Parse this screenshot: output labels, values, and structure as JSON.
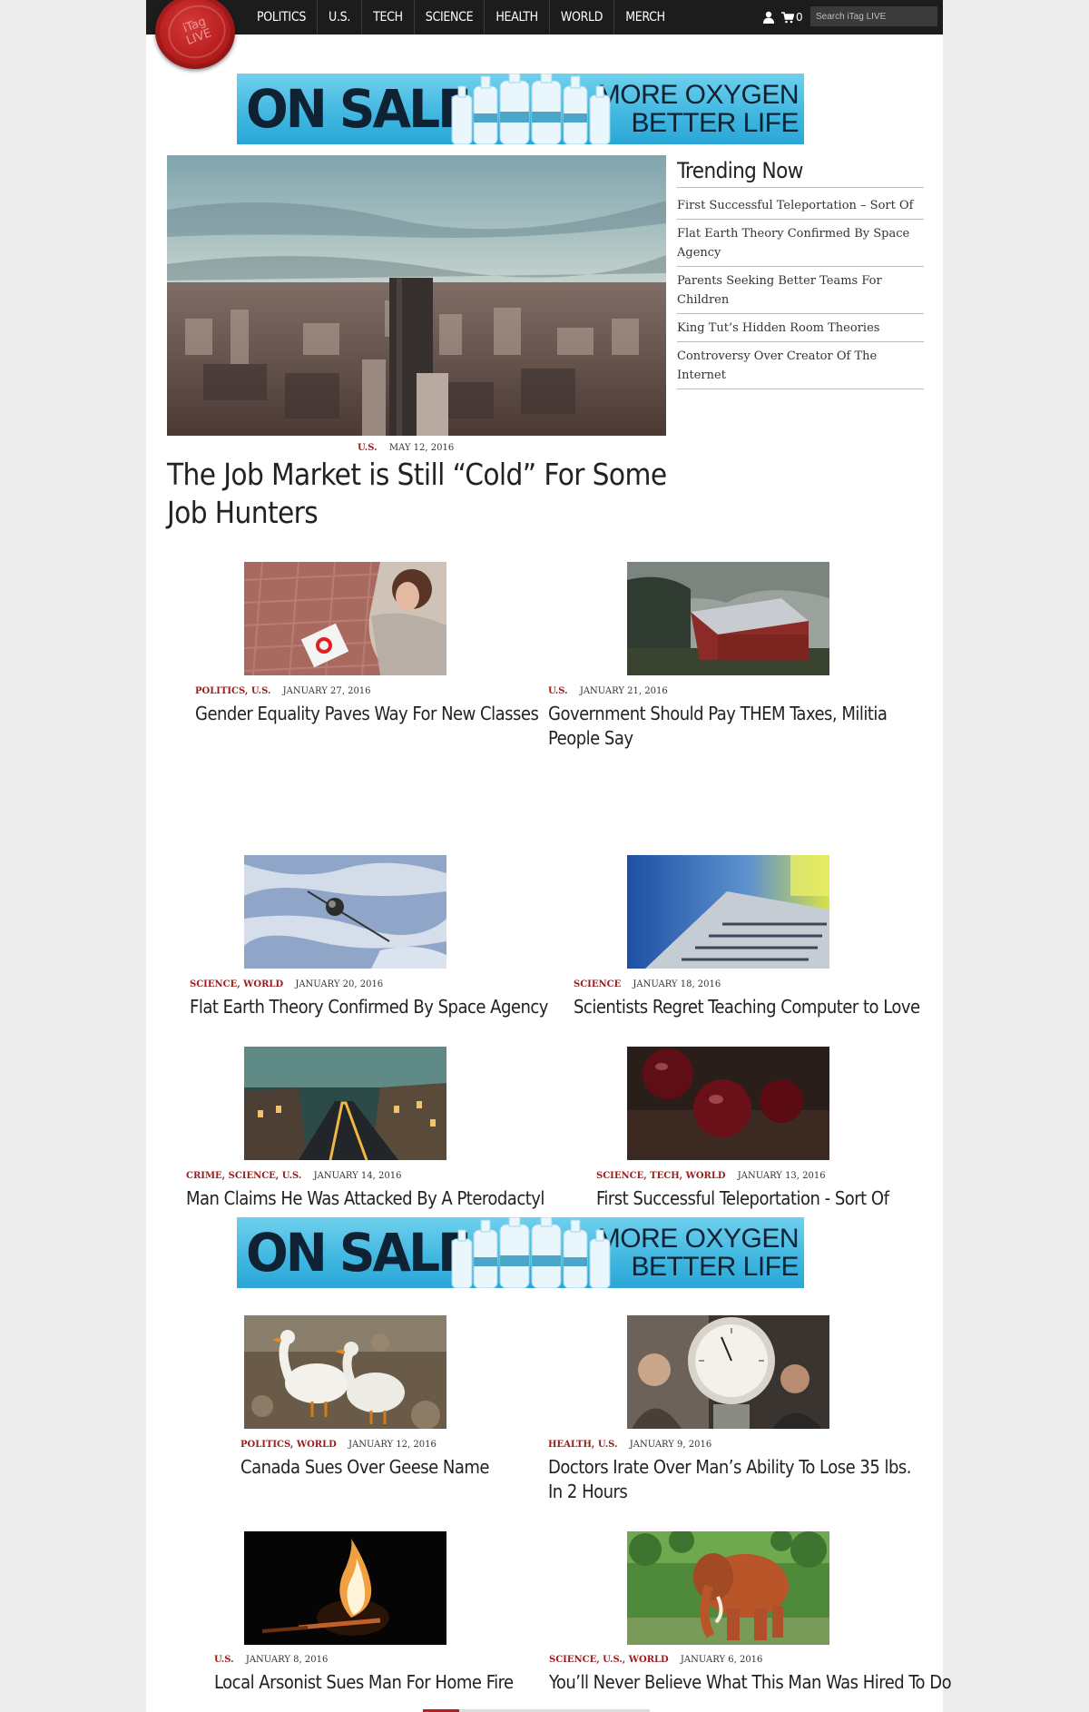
{
  "logo": {
    "line1": "iTag",
    "line2": "LIVE"
  },
  "nav": {
    "items": [
      "POLITICS",
      "U.S.",
      "TECH",
      "SCIENCE",
      "HEALTH",
      "WORLD",
      "MERCH"
    ]
  },
  "header": {
    "cart_count": "0",
    "search_placeholder": "Search iTag LIVE"
  },
  "banner": {
    "left": "ON SALE",
    "right_line1": "MORE OXYGEN",
    "right_line2": "BETTER LIFE"
  },
  "hero": {
    "categories": "U.S.",
    "date": "MAY 12, 2016",
    "title": "The Job Market is Still “Cold” For Some Job Hunters"
  },
  "trending": {
    "heading": "Trending Now",
    "items": [
      "First Successful Teleportation – Sort Of",
      "Flat Earth Theory Confirmed By Space Agency",
      "Parents Seeking Better Teams For Children",
      "King Tut’s Hidden Room Theories",
      "Controversy Over Creator Of The Internet"
    ]
  },
  "articles": [
    {
      "categories": "POLITICS, U.S.",
      "date": "JANUARY 27, 2016",
      "title": "Gender Equality Paves Way For New Classes"
    },
    {
      "categories": "U.S.",
      "date": "JANUARY 21, 2016",
      "title": "Government Should Pay THEM Taxes, Militia People Say"
    },
    {
      "categories": "SCIENCE, WORLD",
      "date": "JANUARY 20, 2016",
      "title": "Flat Earth Theory Confirmed By Space Agency"
    },
    {
      "categories": "SCIENCE",
      "date": "JANUARY 18, 2016",
      "title": "Scientists Regret Teaching Computer to Love"
    },
    {
      "categories": "CRIME, SCIENCE, U.S.",
      "date": "JANUARY 14, 2016",
      "title": "Man Claims He Was Attacked By A Pterodactyl"
    },
    {
      "categories": "SCIENCE, TECH, WORLD",
      "date": "JANUARY 13, 2016",
      "title": "First Successful Teleportation - Sort Of"
    },
    {
      "categories": "POLITICS, WORLD",
      "date": "JANUARY 12, 2016",
      "title": "Canada Sues Over Geese Name"
    },
    {
      "categories": "HEALTH, U.S.",
      "date": "JANUARY 9, 2016",
      "title": "Doctors Irate Over Man’s Ability To Lose 35 lbs. In 2 Hours"
    },
    {
      "categories": "U.S.",
      "date": "JANUARY 8, 2016",
      "title": "Local Arsonist Sues Man For Home Fire"
    },
    {
      "categories": "SCIENCE, U.S., WORLD",
      "date": "JANUARY 6, 2016",
      "title": "You’ll Never Believe What This Man Was Hired To Do"
    }
  ],
  "icons": {
    "user": "user-icon",
    "cart": "cart-icon",
    "logo": "wax-seal-logo"
  },
  "colors": {
    "nav_bg": "#1c1c1c",
    "category": "#9b1c1c",
    "banner": "#3fb6e0",
    "logo": "#b81e1e"
  }
}
